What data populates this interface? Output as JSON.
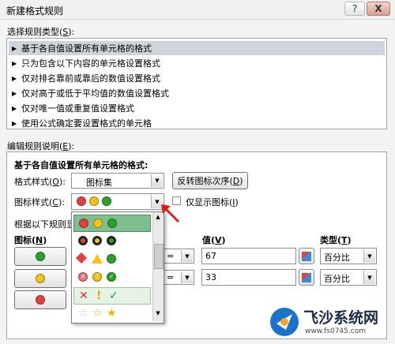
{
  "window": {
    "title": "新建格式规则",
    "help_glyph": "?",
    "close_glyph": "X"
  },
  "rule_type": {
    "label": "选择规则类型(",
    "label_key": "S",
    "label_end": "):",
    "items": [
      "基于各自值设置所有单元格的格式",
      "只为包含以下内容的单元格设置格式",
      "仅对排名靠前或靠后的数值设置格式",
      "仅对高于或低于平均值的数值设置格式",
      "仅对唯一值或重复值设置格式",
      "使用公式确定要设置格式的单元格"
    ],
    "selected_index": 0
  },
  "description": {
    "label": "编辑规则说明(",
    "label_key": "E",
    "label_end": "):",
    "heading": "基于各自值设置所有单元格的格式:",
    "format_style_label": "格式样式(",
    "format_style_key": "O",
    "format_style_end": "):",
    "format_style_value": "图标集",
    "reverse_button": "反转图标次序(",
    "reverse_key": "D",
    "reverse_end": ")",
    "icon_style_label": "图标样式(",
    "icon_style_key": "C",
    "icon_style_end": "):",
    "show_icon_only_label": "仅显示图标(",
    "show_icon_only_key": "I",
    "show_icon_only_end": ")",
    "show_icon_only_checked": false,
    "rules_label": "根据以下规则显",
    "col_icon": "图标(",
    "col_icon_key": "N",
    "col_icon_end": ")",
    "col_value": "值(",
    "col_value_key": "V",
    "col_value_end": ")",
    "col_type": "类型(",
    "col_type_key": "T",
    "col_type_end": ")",
    "rows": [
      {
        "icon_color": "#2aa12a",
        "operator": "=",
        "value": "67",
        "type": "百分比"
      },
      {
        "icon_color": "#f2c41a",
        "operator": "=",
        "value": "33",
        "type": "百分比"
      },
      {
        "icon_color": "#e04040",
        "operator": "",
        "value": "",
        "type": ""
      }
    ]
  },
  "icon_popup": {
    "options": [
      "三色交通灯(无边框)",
      "三色交通灯(有边框)",
      "三个标志",
      "三个符号(有圆圈)",
      "三个符号(无圆圈)",
      "三个星形"
    ],
    "symbols_row": [
      "✕",
      "!",
      "✓"
    ],
    "stars_row": [
      "☆",
      "☆",
      "★"
    ]
  },
  "watermark": {
    "brand": "飞沙系统网",
    "url": "www.fs0745.com"
  },
  "colors": {
    "green": "#2aa12a",
    "yellow": "#f2c41a",
    "red": "#e04040",
    "selected_bg": "#cfd3da",
    "popup_selected": "#7fbf8f"
  }
}
